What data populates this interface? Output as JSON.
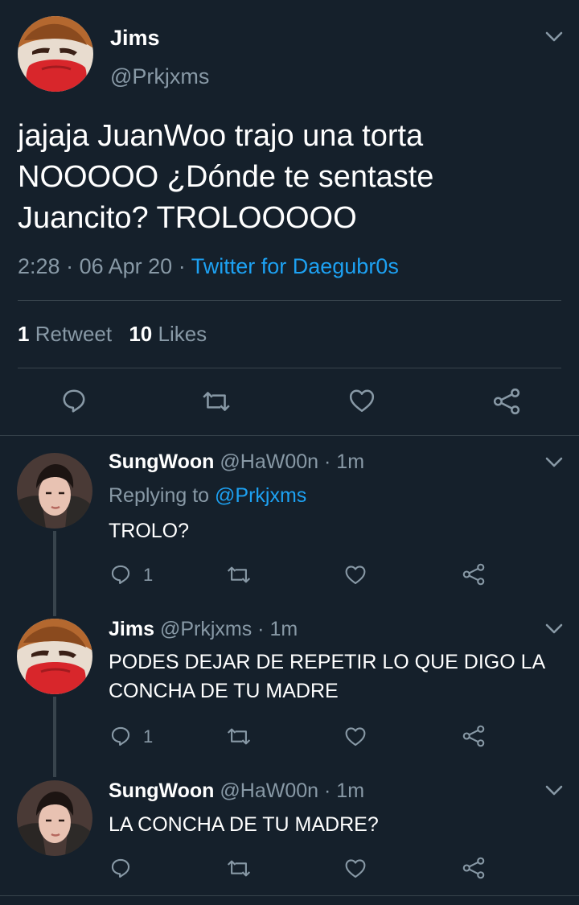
{
  "main_tweet": {
    "display_name": "Jims",
    "handle": "@Prkjxms",
    "text_lines": [
      "jajaja JuanWoo trajo una torta",
      "NOOOOO ¿Dónde te sentaste",
      "Juancito? TROLOOOOO"
    ],
    "time": "2:28",
    "date": "06 Apr 20",
    "separator": "·",
    "source": "Twitter for Daegubr0s",
    "retweet_count": "1",
    "retweet_label": "Retweet",
    "like_count": "10",
    "like_label": "Likes"
  },
  "replies": [
    {
      "display_name": "SungWoon",
      "handle": "@HaW00n",
      "time": "1m",
      "replying_label": "Replying to",
      "replying_to": "@Prkjxms",
      "text_lines": [
        "TROLO?"
      ],
      "reply_count": "1"
    },
    {
      "display_name": "Jims",
      "handle": "@Prkjxms",
      "time": "1m",
      "text_lines": [
        "PODES DEJAR DE REPETIR LO QUE DIGO LA",
        "CONCHA DE TU MADRE"
      ],
      "reply_count": "1"
    },
    {
      "display_name": "SungWoon",
      "handle": "@HaW00n",
      "time": "1m",
      "text_lines": [
        "LA CONCHA DE TU MADRE?"
      ],
      "reply_count": ""
    }
  ],
  "colors": {
    "background": "#15202b",
    "accent": "#1da1f2",
    "muted": "#8899a6",
    "divider": "#38444d"
  },
  "icons": [
    "chevron-down-icon",
    "reply-icon",
    "retweet-icon",
    "heart-icon",
    "share-icon"
  ]
}
